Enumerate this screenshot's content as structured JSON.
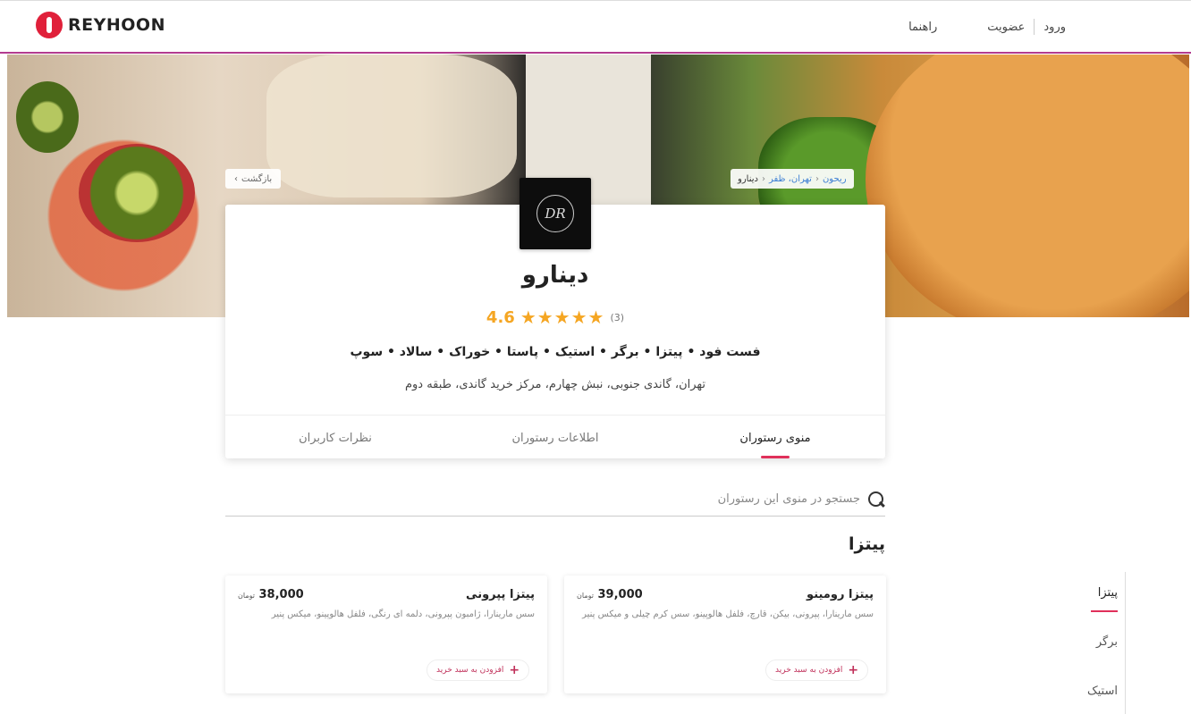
{
  "brand": {
    "name": "REYHOON"
  },
  "topnav": {
    "login": "ورود",
    "signup": "عضویت",
    "guide": "راهنما"
  },
  "hero": {
    "back_label": "بازگشت",
    "breadcrumb": {
      "home": "ریحون",
      "city": "تهران، ظفر",
      "current": "دینارو"
    }
  },
  "restaurant": {
    "logo_initials": "DR",
    "name": "دینارو",
    "rating": "4.6",
    "stars": "★★★★★",
    "rating_count": "(3)",
    "cuisines": "فست فود • پیتزا • برگر • استیک • پاستا • خوراک • سالاد • سوپ",
    "address": "تهران، گاندی جنوبی، نبش چهارم، مرکز خرید گاندی، طبقه دوم"
  },
  "tabs": [
    {
      "label": "منوی رستوران",
      "active": true
    },
    {
      "label": "اطلاعات رستوران",
      "active": false
    },
    {
      "label": "نظرات کاربران",
      "active": false
    }
  ],
  "search": {
    "placeholder": "جستجو در منوی این رستوران"
  },
  "section": {
    "title": "پیتزا"
  },
  "foods": [
    {
      "name": "پیتزا رومینو",
      "price": "39,000",
      "currency": "تومان",
      "desc": "سس مارینارا، پپرونی، بیکن، قارچ، فلفل هالوپینو، سس کرم چیلی و میکس پنیر",
      "add_label": "افزودن به سبد خرید"
    },
    {
      "name": "پیتزا پپرونی",
      "price": "38,000",
      "currency": "تومان",
      "desc": "سس مارینارا، ژامبون پپرونی، دلمه ای رنگی، فلفل هالوپینو، میکس پنیر",
      "add_label": "افزودن به سبد خرید"
    }
  ],
  "categories": [
    {
      "label": "پیتزا",
      "active": true
    },
    {
      "label": "برگر",
      "active": false
    },
    {
      "label": "استیک",
      "active": false
    }
  ],
  "colors": {
    "accent": "#e0305a",
    "star": "#f5a623",
    "link": "#3d7fd4",
    "nav_border": "#b33b8f"
  }
}
